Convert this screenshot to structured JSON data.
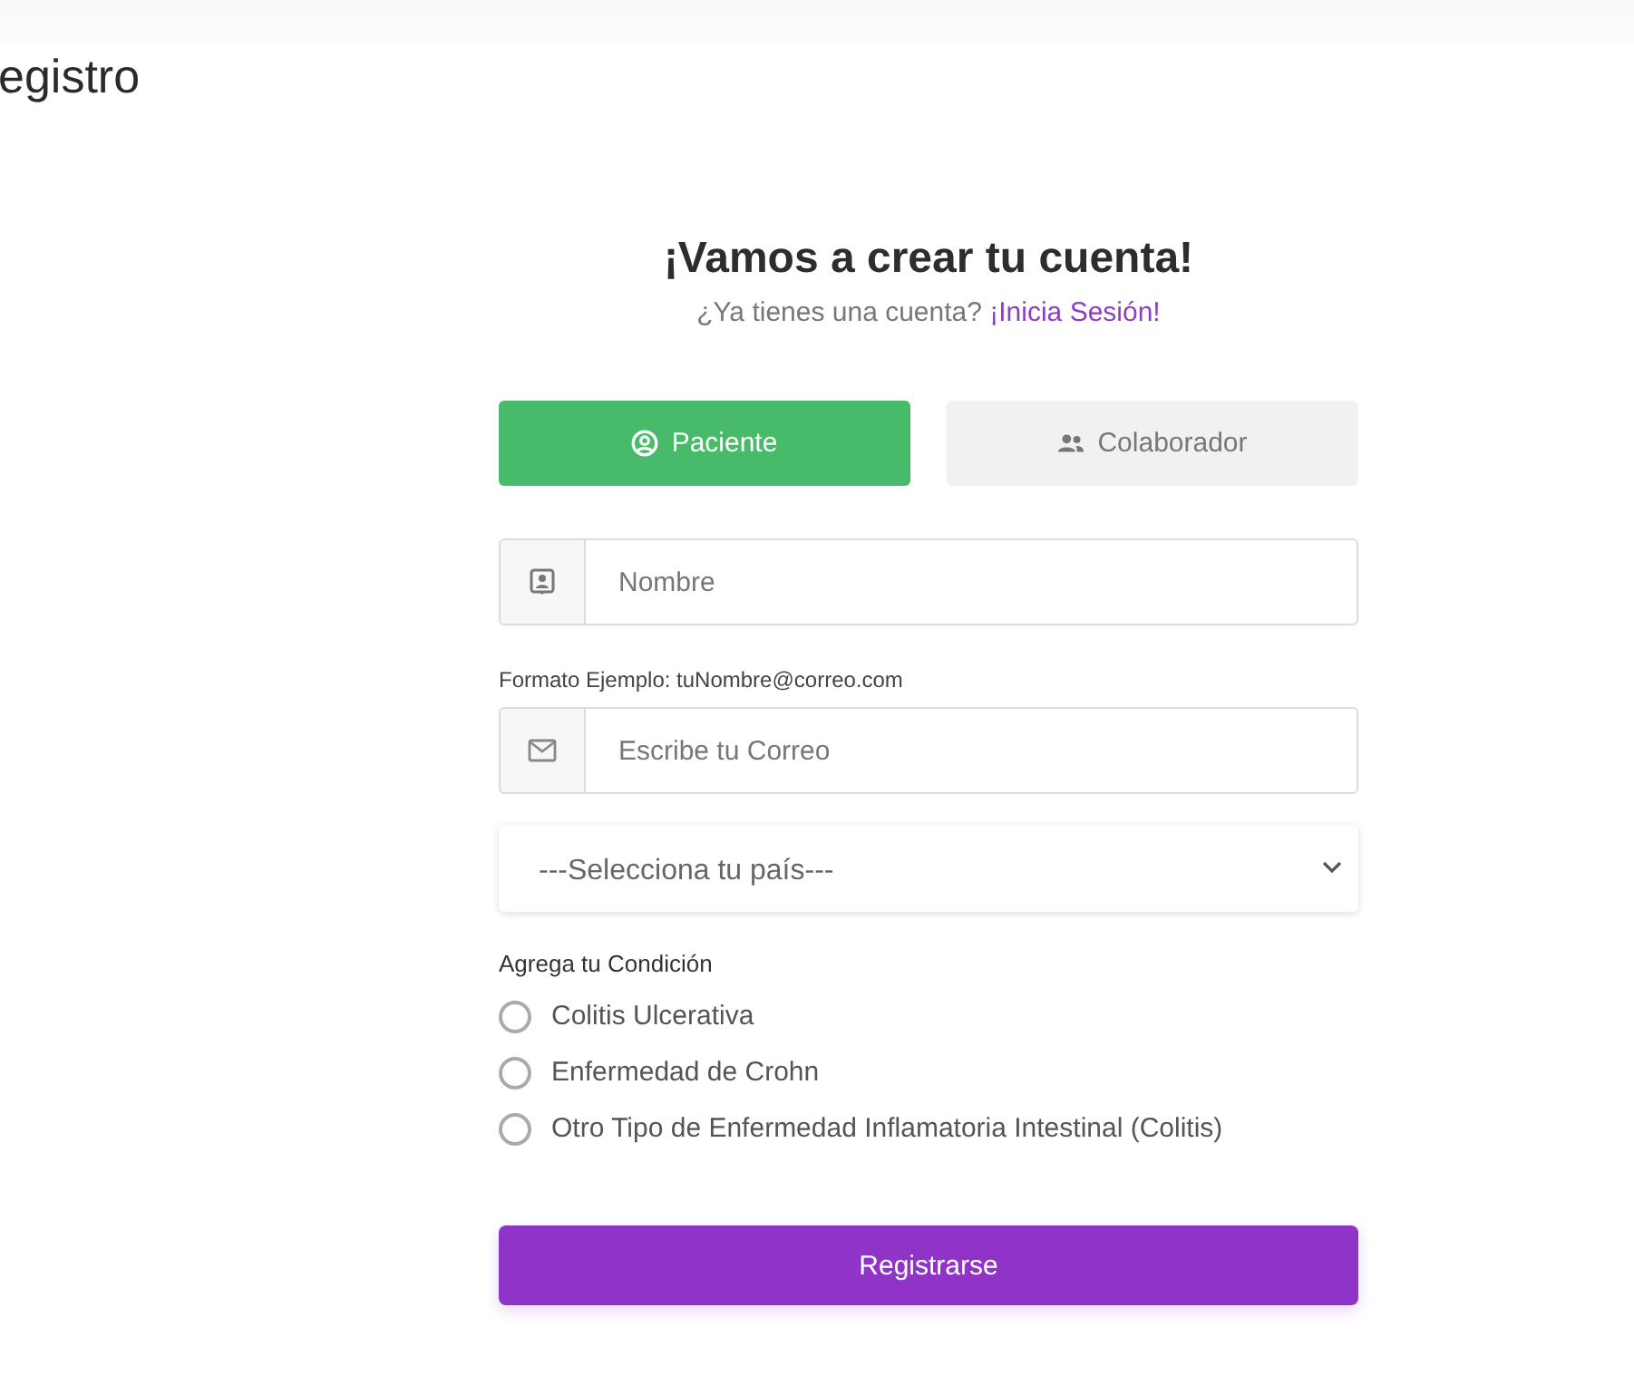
{
  "page": {
    "title": "egistro"
  },
  "form": {
    "heading": "¡Vamos a crear tu cuenta!",
    "subtitle": "¿Ya tienes una cuenta?",
    "login_link": "¡Inicia Sesión!",
    "roles": [
      {
        "label": "Paciente",
        "selected": true,
        "kind": "patient"
      },
      {
        "label": "Colaborador",
        "selected": false,
        "kind": "team"
      }
    ],
    "name_field": {
      "placeholder": "Nombre"
    },
    "email_hint": "Formato Ejemplo: tuNombre@correo.com",
    "email_field": {
      "placeholder": "Escribe tu Correo"
    },
    "country_select": {
      "value": "---Selecciona tu país---"
    },
    "condition_label": "Agrega tu Condición",
    "conditions": [
      {
        "label": "Colitis Ulcerativa",
        "selected": false
      },
      {
        "label": "Enfermedad de Crohn",
        "selected": false
      },
      {
        "label": "Otro Tipo de Enfermedad Inflamatoria Intestinal (Colitis)",
        "selected": false
      }
    ],
    "submit": "Registrarse"
  }
}
